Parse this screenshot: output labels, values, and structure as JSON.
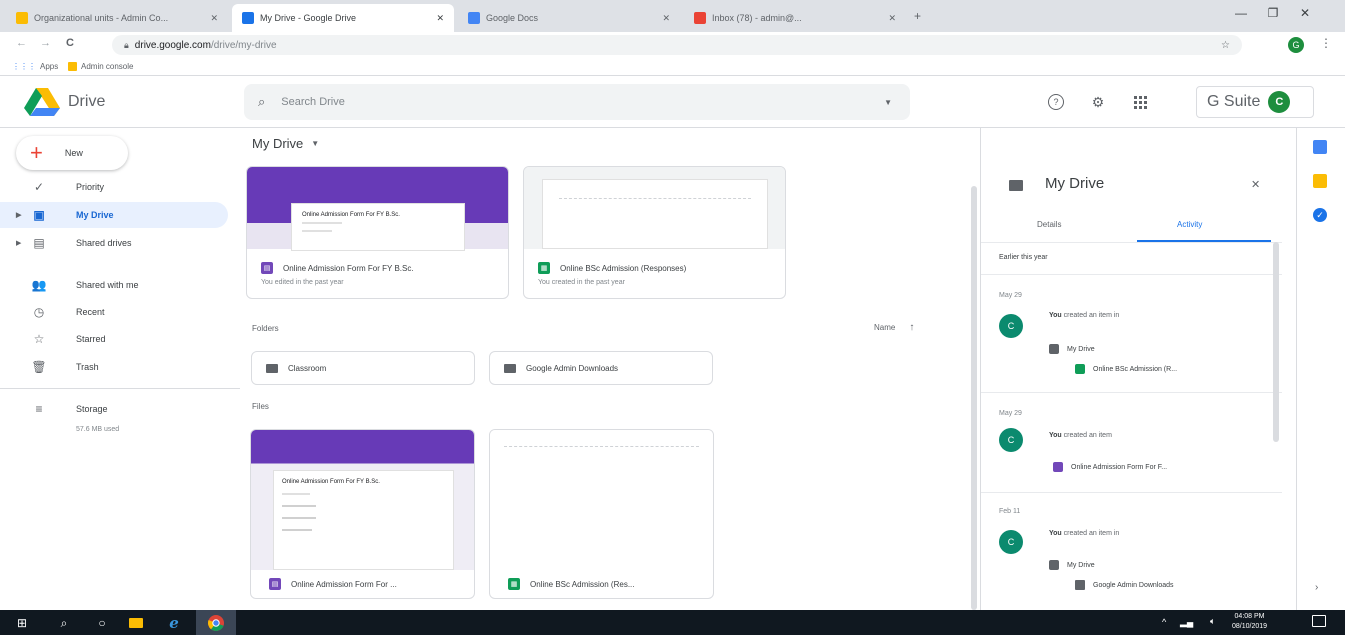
{
  "browser": {
    "tabs": [
      {
        "label": "Organizational units - Admin Co...",
        "favicon_color": "#fbbc04"
      },
      {
        "label": "My Drive - Google Drive",
        "favicon_color": "#1a73e8"
      },
      {
        "label": "Google Docs",
        "favicon_color": "#4285f4"
      },
      {
        "label": "Inbox (78) - admin@...",
        "favicon_color": "#ea4335"
      }
    ],
    "new_tab": "+",
    "window_controls": {
      "minimize": "—",
      "maximize": "❐",
      "close": "✕"
    },
    "nav": {
      "back": "←",
      "forward": "→",
      "reload": "C"
    },
    "url_host": "drive.google.com",
    "url_path": "/drive/my-drive",
    "star": "☆",
    "profile_initial": "G",
    "menu": "⋮",
    "bookmarks": [
      {
        "label": "Apps"
      },
      {
        "label": "Admin console"
      }
    ]
  },
  "header": {
    "app_name": "Drive",
    "search_placeholder": "Search Drive",
    "help_icon": "?",
    "settings_icon": "⚙",
    "apps_icon": "⋮⋮⋮",
    "suite_label": "G Suite",
    "avatar_initial": "C",
    "avatar_color": "#1e8e3e"
  },
  "sidebar": {
    "new_label": "New",
    "items": [
      {
        "label": "Priority",
        "icon": "✓"
      },
      {
        "label": "My Drive",
        "icon": "▣"
      },
      {
        "label": "Shared drives",
        "icon": "▤"
      },
      {
        "label": "Shared with me",
        "icon": "👥"
      },
      {
        "label": "Recent",
        "icon": "◷"
      },
      {
        "label": "Starred",
        "icon": "☆"
      },
      {
        "label": "Trash",
        "icon": "🗑"
      },
      {
        "label": "Storage",
        "icon": "≡"
      }
    ],
    "storage_used": "57.6 MB used"
  },
  "main": {
    "title": "My Drive",
    "quick_access": [
      {
        "name": "Online Admission Form For FY B.Sc.",
        "sub": "You edited in the past year",
        "thumb_text": "Online Admission Form For FY B.Sc."
      },
      {
        "name": "Online BSc Admission (Responses)",
        "sub": "You created in the past year"
      }
    ],
    "folders_label": "Folders",
    "sort_label": "Name",
    "sort_icon": "↑",
    "folders": [
      {
        "name": "Classroom"
      },
      {
        "name": "Google Admin Downloads"
      }
    ],
    "files_label": "Files",
    "files": [
      {
        "name": "Online Admission Form For ...",
        "thumb_text": "Online Admission Form For FY B.Sc."
      },
      {
        "name": "Online BSc Admission (Res..."
      }
    ]
  },
  "panel": {
    "title": "My Drive",
    "close": "✕",
    "tabs": {
      "details": "Details",
      "activity": "Activity"
    },
    "period": "Earlier this year",
    "activities": [
      {
        "date": "May 29",
        "text": "created an item in",
        "location": "My Drive",
        "file": "Online BSc Admission (R..."
      },
      {
        "date": "May 29",
        "text": "created an item",
        "file": "Online Admission Form For F..."
      },
      {
        "date": "Feb 11",
        "text": "created an item in",
        "location": "My Drive",
        "file": "Google Admin Downloads"
      }
    ],
    "actor": "You",
    "actor_initial": "C"
  },
  "taskbar": {
    "time": "04:08 PM",
    "date": "08/10/2019",
    "start": "⊞",
    "search": "⌕",
    "cortana": "○"
  }
}
